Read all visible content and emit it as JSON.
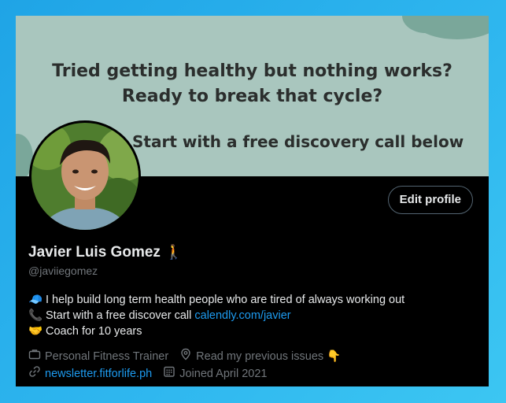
{
  "banner": {
    "headline_line1": "Tried getting healthy but nothing works?",
    "headline_line2": "Ready to break that cycle?",
    "cta": "Start with a free discovery call below"
  },
  "profile": {
    "edit_button": "Edit profile",
    "name": "Javier Luis Gomez",
    "name_emoji": "🚶",
    "handle": "@javiiegomez",
    "bio": [
      {
        "icon": "🧢",
        "text": "I help build long term health people who are tired of always working out"
      },
      {
        "icon": "📞",
        "text": "Start with a free discover call ",
        "link": "calendly.com/javier"
      },
      {
        "icon": "🤝",
        "text": "Coach for 10 years"
      }
    ],
    "meta": {
      "category": "Personal Fitness Trainer",
      "location": "Read my previous issues",
      "location_emoji": "👇",
      "website": "newsletter.fitforlife.ph",
      "joined": "Joined April 2021"
    }
  },
  "colors": {
    "banner_bg": "#a9c6be",
    "card_bg": "#000000",
    "link": "#1d9bf0",
    "muted": "#71767b"
  }
}
